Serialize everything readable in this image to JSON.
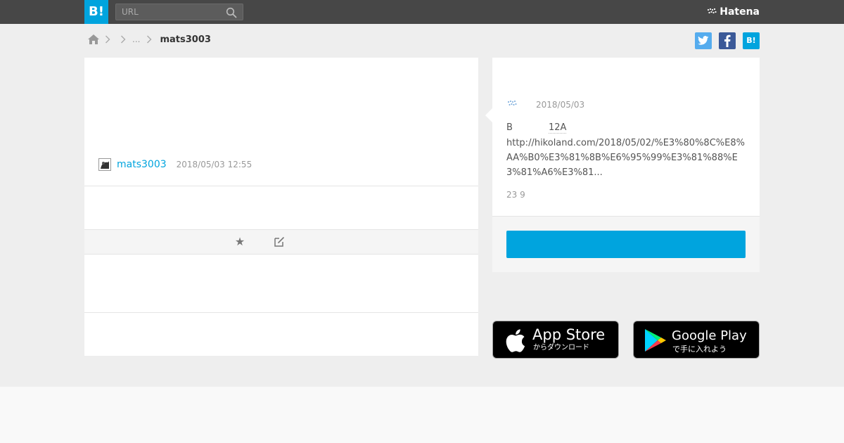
{
  "header": {
    "logo_text": "B!",
    "search_placeholder": "URL",
    "brand_text": "Hatena"
  },
  "breadcrumb": {
    "ellipsis": "...",
    "current": "mats3003"
  },
  "share": {
    "twitter": "t",
    "facebook": "f",
    "hatena": "B!"
  },
  "bookmark": {
    "username": "mats3003",
    "timestamp": "2018/05/03 12:55"
  },
  "entry": {
    "date": "2018/05/03",
    "title_prefix": "B",
    "title_count": "12A",
    "url": "http://hikoland.com/2018/05/02/%E3%80%8C%E8%AA%B0%E3%81%8B%E6%95%99%E3%81%88%E3%81%A6%E3%81...",
    "count": "23 9"
  },
  "apps": {
    "apple_big": "App Store",
    "apple_small": "からダウンロード",
    "google_big": "Google Play",
    "google_small": "で手に入れよう"
  },
  "colors": {
    "brand_blue": "#00a4de",
    "header_bg": "#474747"
  }
}
